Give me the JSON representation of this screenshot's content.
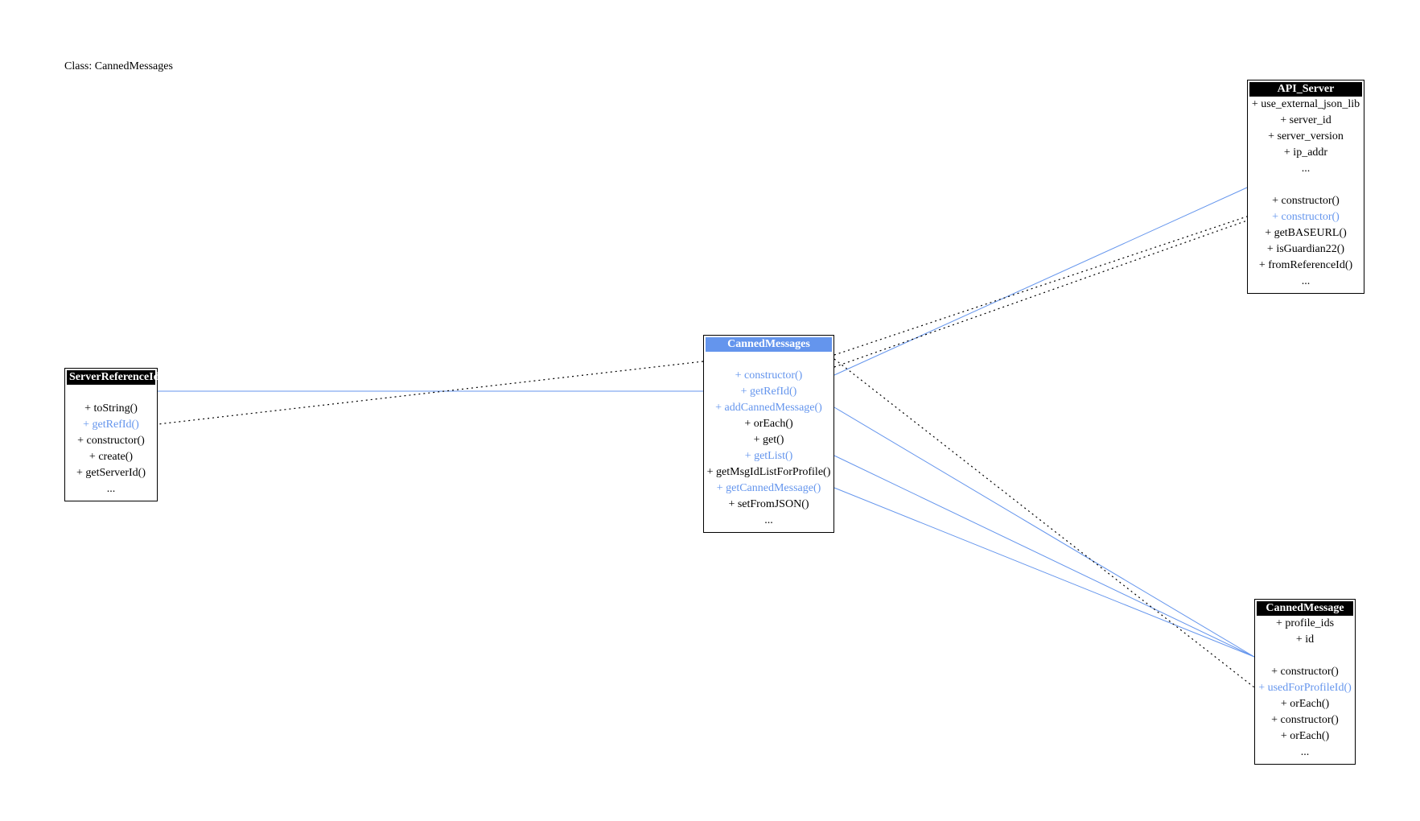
{
  "title": "Class: CannedMessages",
  "colors": {
    "linked_member": "#6495ed",
    "focus_header": "#6495ed",
    "header": "#000000",
    "line": "#000000"
  },
  "classes": {
    "server_reference_id": {
      "name": "ServerReferenceId",
      "attributes": [],
      "methods": [
        "+ toString()",
        "+ getRefId()",
        "+ constructor()",
        "+ create()",
        "+ getServerId()",
        "..."
      ],
      "linked_methods": [
        1
      ]
    },
    "canned_messages": {
      "name": "CannedMessages",
      "attributes": [],
      "methods": [
        "+ constructor()",
        "+ getRefId()",
        "+ addCannedMessage()",
        "+ orEach()",
        "+ get()",
        "+ getList()",
        "+ getMsgIdListForProfile()",
        "+ getCannedMessage()",
        "+ setFromJSON()",
        "..."
      ],
      "linked_methods": [
        0,
        1,
        2,
        5,
        7
      ]
    },
    "api_server": {
      "name": "API_Server",
      "attributes": [
        "+ use_external_json_lib",
        "+ server_id",
        "+ server_version",
        "+ ip_addr",
        "..."
      ],
      "methods": [
        "+ constructor()",
        "+ constructor()",
        "+ getBASEURL()",
        "+ isGuardian22()",
        "+ fromReferenceId()",
        "..."
      ],
      "linked_methods": [
        1
      ]
    },
    "canned_message": {
      "name": "CannedMessage",
      "attributes": [
        "+ profile_ids",
        "+ id"
      ],
      "methods": [
        "+ constructor()",
        "+ usedForProfileId()",
        "+ orEach()",
        "+ constructor()",
        "+ orEach()",
        "..."
      ],
      "linked_methods": [
        1
      ]
    }
  },
  "relations": {
    "solid": [
      {
        "from": "canned_messages.methods.1",
        "to": "server_reference_id"
      },
      {
        "from": "canned_messages.methods.0",
        "to": "api_server"
      },
      {
        "from": "canned_messages.methods.2",
        "to": "canned_message"
      },
      {
        "from": "canned_messages.methods.5",
        "to": "canned_message"
      },
      {
        "from": "canned_messages.methods.7",
        "to": "canned_message"
      }
    ],
    "dotted": [
      {
        "from": "canned_messages",
        "to": "server_reference_id.methods.1"
      },
      {
        "from": "canned_messages",
        "to": "api_server.methods.1"
      },
      {
        "from": "canned_messages",
        "to": "api_server.methods.1"
      },
      {
        "from": "canned_messages",
        "to": "canned_message.methods.1"
      }
    ]
  }
}
